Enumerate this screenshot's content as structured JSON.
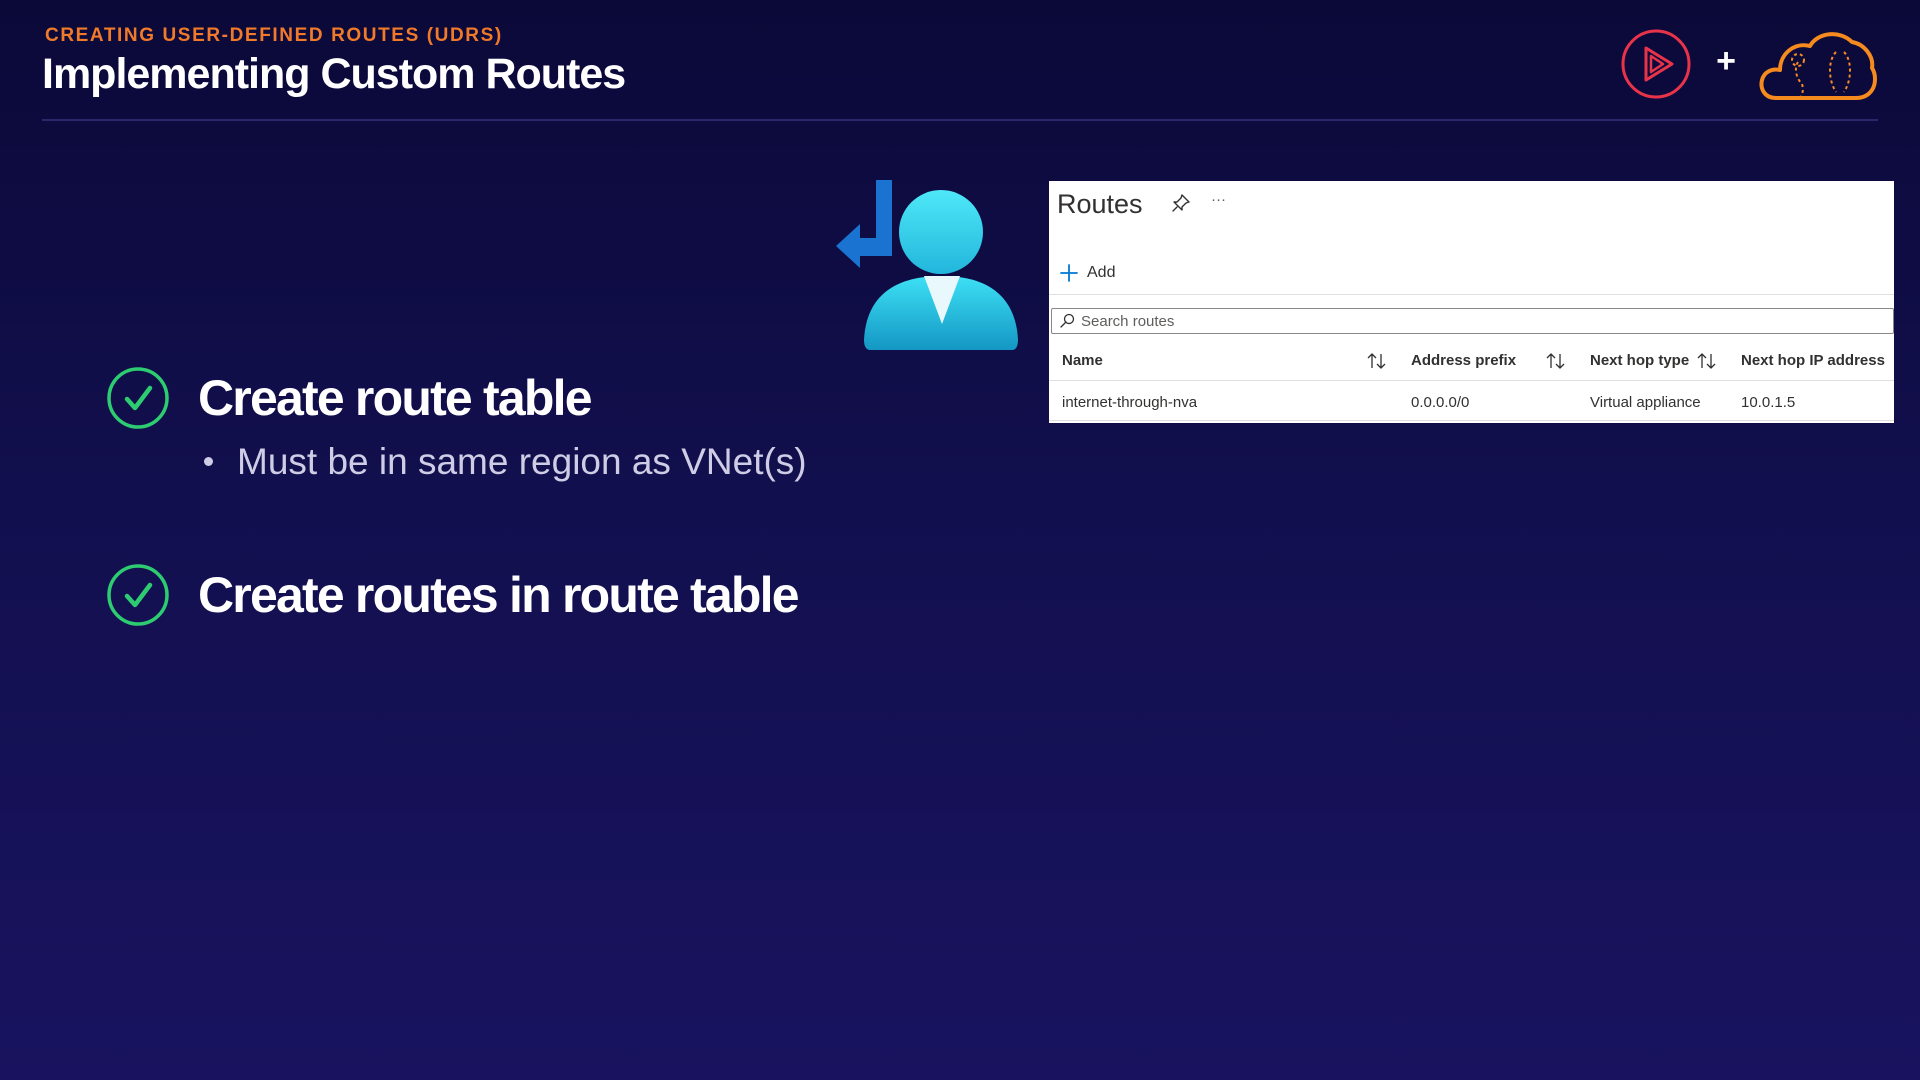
{
  "header": {
    "eyebrow": "CREATING USER-DEFINED ROUTES (UDRS)",
    "title": "Implementing Custom Routes",
    "plus_sign": "+"
  },
  "colors": {
    "accent_orange": "#f07a2a",
    "check_green": "#2ecc71",
    "play_red": "#e8334a",
    "cloud_orange": "#f58a1f",
    "azure_blue": "#0078d4"
  },
  "bullets": [
    {
      "label": "Create route table",
      "sub": [
        "Must be in same region as VNet(s)"
      ]
    },
    {
      "label": "Create routes in route table",
      "sub": []
    }
  ],
  "routes_panel": {
    "title": "Routes",
    "add_label": "Add",
    "search_placeholder": "Search routes",
    "columns": [
      "Name",
      "Address prefix",
      "Next hop type",
      "Next hop IP address"
    ],
    "rows": [
      {
        "name": "internet-through-nva",
        "address_prefix": "0.0.0.0/0",
        "next_hop_type": "Virtual appliance",
        "next_hop_ip": "10.0.1.5"
      }
    ]
  },
  "icons": {
    "brand_play": "play-logo-icon",
    "brand_cloud": "cloud-guru-icon",
    "user_route": "user-route-icon",
    "check": "check-circle-icon",
    "pin": "pin-icon",
    "more": "more-options-icon",
    "add": "plus-icon",
    "search": "search-icon",
    "sort": "sort-arrows-icon"
  }
}
